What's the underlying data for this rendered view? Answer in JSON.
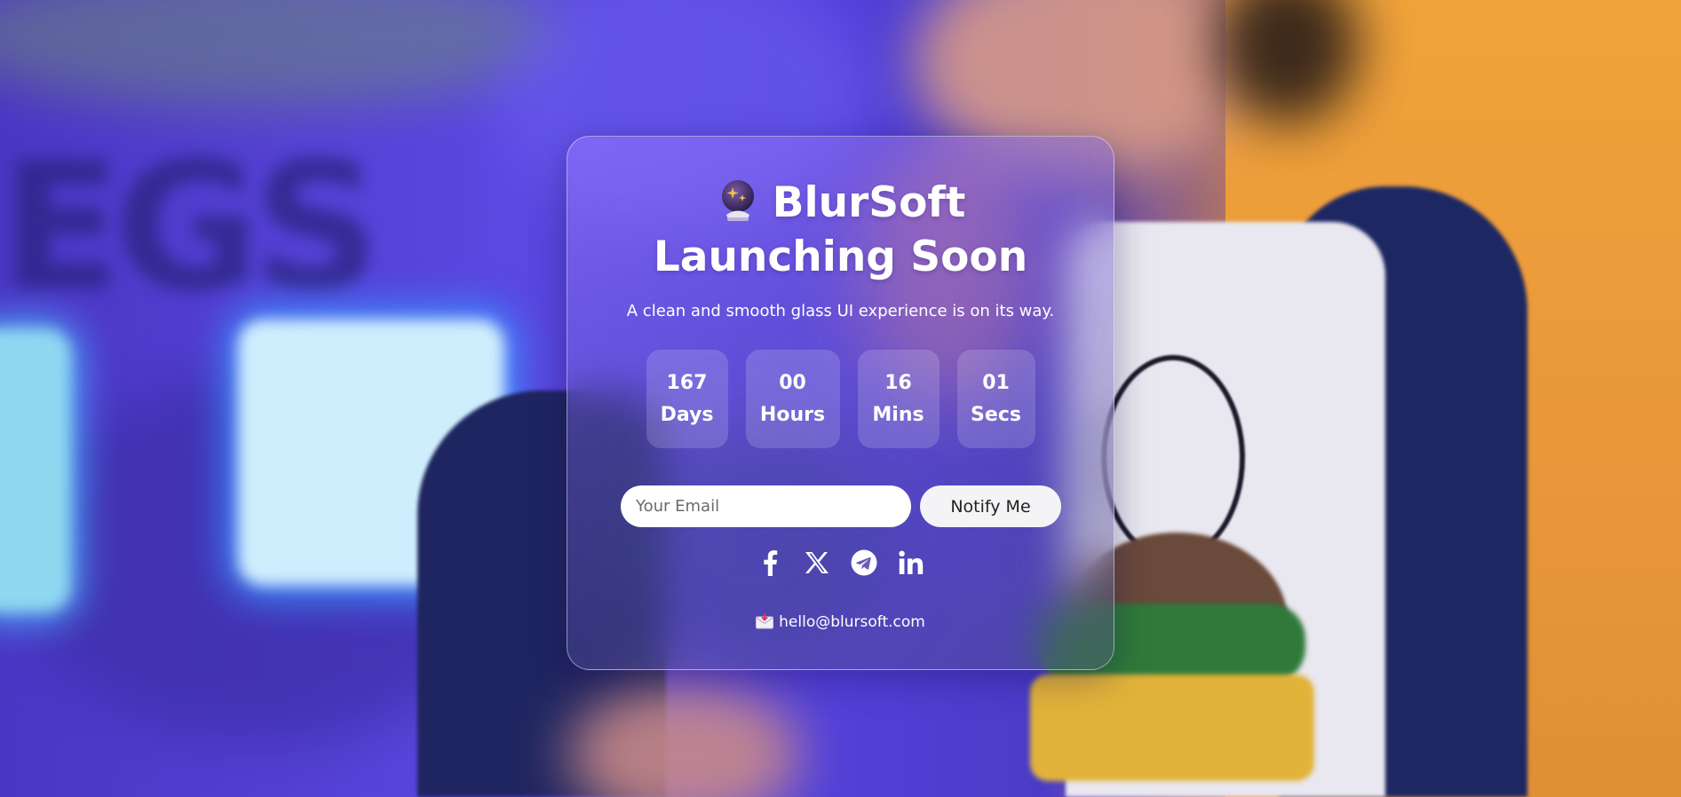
{
  "brand": {
    "icon": "crystal-ball-icon",
    "name": "BlurSoft",
    "headline": "Launching Soon"
  },
  "subtitle": "A clean and smooth glass UI experience is on its way.",
  "countdown": [
    {
      "value": "167",
      "unit": "Days"
    },
    {
      "value": "00",
      "unit": "Hours"
    },
    {
      "value": "16",
      "unit": "Mins"
    },
    {
      "value": "01",
      "unit": "Secs"
    }
  ],
  "form": {
    "email_placeholder": "Your Email",
    "email_value": "",
    "notify_label": "Notify Me"
  },
  "socials": [
    {
      "icon": "facebook-icon"
    },
    {
      "icon": "x-twitter-icon"
    },
    {
      "icon": "telegram-icon"
    },
    {
      "icon": "linkedin-icon"
    }
  ],
  "contact": {
    "icon": "incoming-envelope-icon",
    "email": "hello@blursoft.com"
  },
  "colors": {
    "card_tint": "#8a70ff",
    "button_bg": "#f4f4f6",
    "text": "#ffffff"
  }
}
